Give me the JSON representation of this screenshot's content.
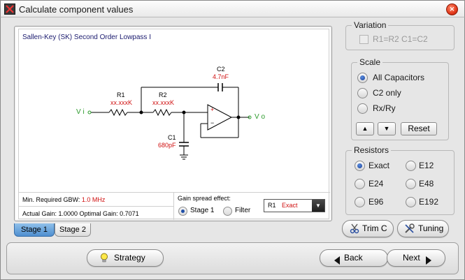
{
  "window": {
    "title": "Calculate component values",
    "close_glyph": "×"
  },
  "circuit": {
    "title": "Sallen-Key (SK) Second Order Lowpass I",
    "labels": {
      "r1_name": "R1",
      "r1_value": "xx.xxxK",
      "r2_name": "R2",
      "r2_value": "xx.xxxK",
      "c1_name": "C1",
      "c1_value": "680pF",
      "c2_name": "C2",
      "c2_value": "4.7nF",
      "vi": "V i",
      "vo": "V o",
      "plus": "+",
      "minus": "−"
    },
    "info": {
      "gbw_label": "Min. Required GBW:",
      "gbw_value": "1.0 MHz",
      "gain_text": "Actual Gain: 1.0000  Optimal Gain: 0.7071"
    },
    "gain_spread": {
      "title": "Gain spread effect:",
      "options": [
        "Stage 1",
        "Filter"
      ],
      "selected": "Stage 1"
    },
    "resistor_select": {
      "label": "R1",
      "value": "Exact",
      "arrow": "▼"
    }
  },
  "stage_tabs": [
    {
      "label": "Stage 1",
      "active": true
    },
    {
      "label": "Stage 2",
      "active": false
    }
  ],
  "variation": {
    "title": "Variation",
    "checkbox_label": "R1=R2  C1=C2",
    "checked": false,
    "disabled": true
  },
  "scale": {
    "title": "Scale",
    "options": [
      "All Capacitors",
      "C2 only",
      "Rx/Ry"
    ],
    "selected": "All Capacitors",
    "up_glyph": "▲",
    "down_glyph": "▼",
    "reset_label": "Reset"
  },
  "resistors": {
    "title": "Resistors",
    "options": [
      "Exact",
      "E12",
      "E24",
      "E48",
      "E96",
      "E192"
    ],
    "selected": "Exact"
  },
  "tools": {
    "trim_label": "Trim C",
    "tuning_label": "Tuning"
  },
  "footer": {
    "strategy_label": "Strategy",
    "back_label": "Back",
    "next_label": "Next"
  },
  "colors": {
    "value_red": "#d01010",
    "signal_green": "#2a9a2a",
    "tab_active": "#4f8fd0",
    "radio_selected": "#1a3f96"
  }
}
